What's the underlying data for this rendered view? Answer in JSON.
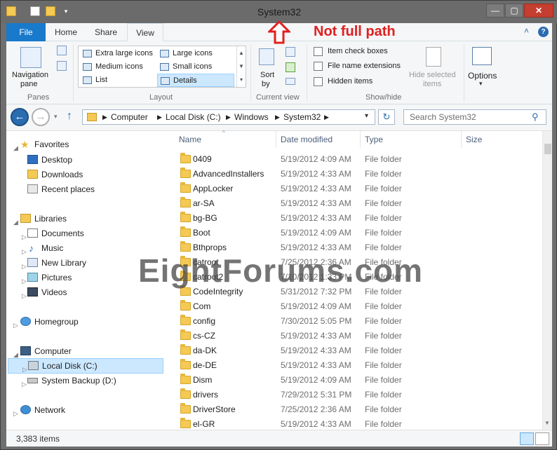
{
  "window": {
    "title": "System32",
    "close_glyph": "✕",
    "min_glyph": "—",
    "max_glyph": "▢"
  },
  "annotation": {
    "text": "Not full path"
  },
  "ribbon": {
    "tabs": [
      {
        "label": "File"
      },
      {
        "label": "Home"
      },
      {
        "label": "Share"
      },
      {
        "label": "View"
      }
    ],
    "panes": {
      "navigation_pane_label": "Navigation",
      "navigation_pane_label2": "pane",
      "group_label": "Panes"
    },
    "layout": {
      "items": [
        {
          "label": "Extra large icons"
        },
        {
          "label": "Large icons"
        },
        {
          "label": "Medium icons"
        },
        {
          "label": "Small icons"
        },
        {
          "label": "List"
        },
        {
          "label": "Details"
        }
      ],
      "group_label": "Layout"
    },
    "current_view": {
      "sort_label": "Sort",
      "sort_label2": "by",
      "group_label": "Current view"
    },
    "show_hide": {
      "checkboxes": [
        {
          "label": "Item check boxes"
        },
        {
          "label": "File name extensions"
        },
        {
          "label": "Hidden items"
        }
      ],
      "hide_selected_label": "Hide selected",
      "hide_selected_label2": "items",
      "group_label": "Show/hide"
    },
    "options_label": "Options"
  },
  "address": {
    "crumbs": [
      "Computer",
      "Local Disk (C:)",
      "Windows",
      "System32"
    ],
    "search_placeholder": "Search System32"
  },
  "nav_pane": {
    "favorites": "Favorites",
    "desktop": "Desktop",
    "downloads": "Downloads",
    "recent": "Recent places",
    "libraries": "Libraries",
    "documents": "Documents",
    "music": "Music",
    "new_library": "New Library",
    "pictures": "Pictures",
    "videos": "Videos",
    "homegroup": "Homegroup",
    "computer": "Computer",
    "local_disk": "Local Disk (C:)",
    "system_backup": "System Backup (D:)",
    "network": "Network"
  },
  "columns": {
    "name": "Name",
    "date": "Date modified",
    "type": "Type",
    "size": "Size"
  },
  "files": [
    {
      "name": "0409",
      "date": "5/19/2012 4:09 AM",
      "type": "File folder"
    },
    {
      "name": "AdvancedInstallers",
      "date": "5/19/2012 4:33 AM",
      "type": "File folder"
    },
    {
      "name": "AppLocker",
      "date": "5/19/2012 4:33 AM",
      "type": "File folder"
    },
    {
      "name": "ar-SA",
      "date": "5/19/2012 4:33 AM",
      "type": "File folder"
    },
    {
      "name": "bg-BG",
      "date": "5/19/2012 4:33 AM",
      "type": "File folder"
    },
    {
      "name": "Boot",
      "date": "5/19/2012 4:09 AM",
      "type": "File folder"
    },
    {
      "name": "Bthprops",
      "date": "5/19/2012 4:33 AM",
      "type": "File folder"
    },
    {
      "name": "catroot",
      "date": "7/25/2012 2:36 AM",
      "type": "File folder"
    },
    {
      "name": "catroot2",
      "date": "7/10/2012 1:33 PM",
      "type": "File folder"
    },
    {
      "name": "CodeIntegrity",
      "date": "5/31/2012 7:32 PM",
      "type": "File folder"
    },
    {
      "name": "Com",
      "date": "5/19/2012 4:09 AM",
      "type": "File folder"
    },
    {
      "name": "config",
      "date": "7/30/2012 5:05 PM",
      "type": "File folder"
    },
    {
      "name": "cs-CZ",
      "date": "5/19/2012 4:33 AM",
      "type": "File folder"
    },
    {
      "name": "da-DK",
      "date": "5/19/2012 4:33 AM",
      "type": "File folder"
    },
    {
      "name": "de-DE",
      "date": "5/19/2012 4:33 AM",
      "type": "File folder"
    },
    {
      "name": "Dism",
      "date": "5/19/2012 4:09 AM",
      "type": "File folder"
    },
    {
      "name": "drivers",
      "date": "7/29/2012 5:31 PM",
      "type": "File folder"
    },
    {
      "name": "DriverStore",
      "date": "7/25/2012 2:36 AM",
      "type": "File folder"
    },
    {
      "name": "el-GR",
      "date": "5/19/2012 4:33 AM",
      "type": "File folder"
    }
  ],
  "watermark": "EightForums.com",
  "status": {
    "count": "3,383 items"
  },
  "colors": {
    "accent": "#1979ca",
    "selection": "#cce8ff",
    "annotation": "#e02020"
  }
}
